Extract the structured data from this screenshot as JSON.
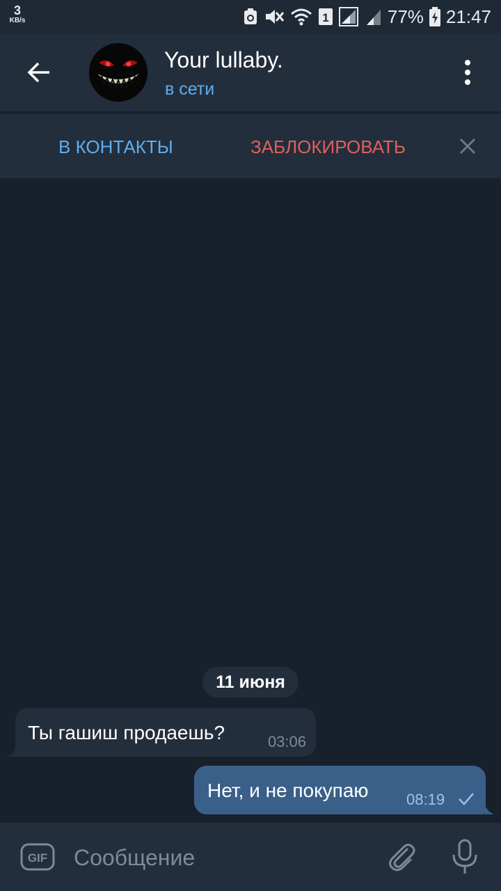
{
  "status_bar": {
    "net_speed": "3",
    "net_unit": "KB/s",
    "sim_number": "1",
    "battery_percent": "77%",
    "time": "21:47"
  },
  "header": {
    "back_icon": "arrow-left-icon",
    "name": "Your lullaby.",
    "status": "в сети",
    "menu_icon": "more-vertical-icon"
  },
  "action_bar": {
    "add_contact": "В КОНТАКТЫ",
    "block": "ЗАБЛОКИРОВАТЬ",
    "close_icon": "close-icon"
  },
  "chat": {
    "date_label": "11 июня",
    "messages": [
      {
        "direction": "incoming",
        "text": "Ты гашиш продаешь?",
        "time": "03:06"
      },
      {
        "direction": "outgoing",
        "text": "Нет, и не покупаю",
        "time": "08:19",
        "status_icon": "check-icon"
      }
    ]
  },
  "input_bar": {
    "gif_label": "GIF",
    "placeholder": "Сообщение",
    "attach_icon": "paperclip-icon",
    "mic_icon": "microphone-icon"
  },
  "colors": {
    "background": "#18202b",
    "header": "#232e3c",
    "accent": "#5eaef0",
    "danger": "#e0605c",
    "outgoing_bubble": "#3a6089"
  }
}
